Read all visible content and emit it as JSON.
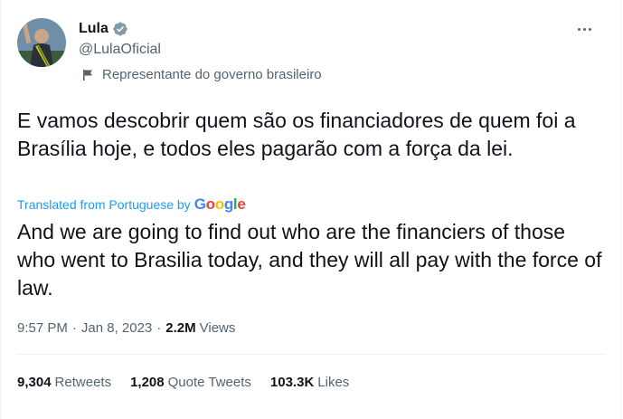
{
  "author": {
    "name": "Lula",
    "handle": "@LulaOficial",
    "label": "Representante do governo brasileiro"
  },
  "tweet": {
    "original_text": "E vamos descobrir quem são os financiadores de quem foi a Brasília hoje, e todos eles pagarão com a força da lei.",
    "translated_from": "Translated from Portuguese by",
    "translator": "Google",
    "translated_text": "And we are going to find out who are the financiers of those who went to Brasilia today, and they will all pay with the force of law."
  },
  "meta": {
    "time": "9:57 PM",
    "separator": "·",
    "date": "Jan 8, 2023",
    "views_count": "2.2M",
    "views_label": "Views"
  },
  "stats": {
    "retweets": {
      "count": "9,304",
      "label": "Retweets"
    },
    "quotes": {
      "count": "1,208",
      "label": "Quote Tweets"
    },
    "likes": {
      "count": "103.3K",
      "label": "Likes"
    }
  },
  "colors": {
    "accent": "#1d9bf0",
    "text": "#0f1419",
    "secondary": "#536471"
  }
}
